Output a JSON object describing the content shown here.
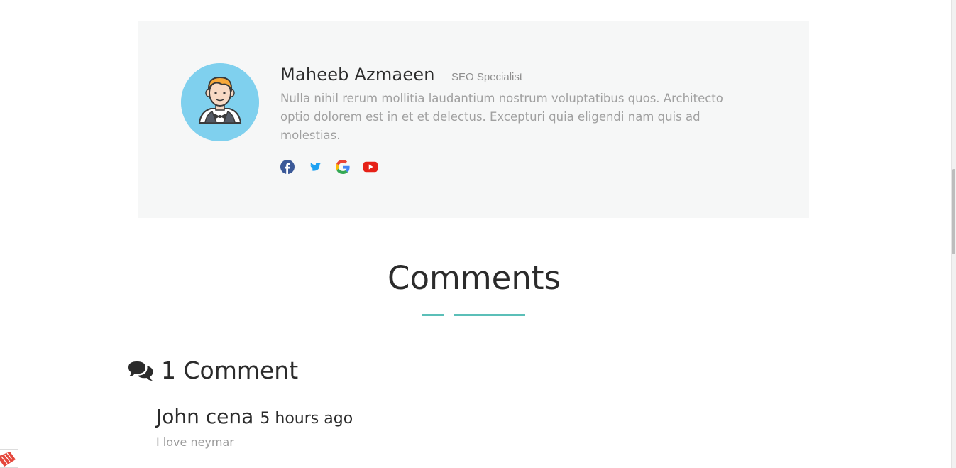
{
  "author": {
    "name": "Maheeb Azmaeen",
    "role": "SEO Specialist",
    "bio": "Nulla nihil rerum mollitia laudantium nostrum voluptatibus quos. Architecto optio dolorem est in et et delectus. Excepturi quia eligendi nam quis ad molestias.",
    "avatar_icon": "person-avatar-icon",
    "avatar_bg": "#7fd0ee",
    "social": [
      {
        "name": "facebook-icon",
        "color": "#3b5998"
      },
      {
        "name": "twitter-icon",
        "color": "#1da1f2"
      },
      {
        "name": "google-icon",
        "color": "#4285f4"
      },
      {
        "name": "youtube-icon",
        "color": "#e62117"
      }
    ]
  },
  "comments_section": {
    "title": "Comments",
    "accent_color": "#5bbfb8",
    "count_icon": "comments-icon",
    "count_label": "1 Comment",
    "items": [
      {
        "author": "John cena",
        "time": "5 hours ago",
        "body": "I love neymar"
      }
    ]
  }
}
